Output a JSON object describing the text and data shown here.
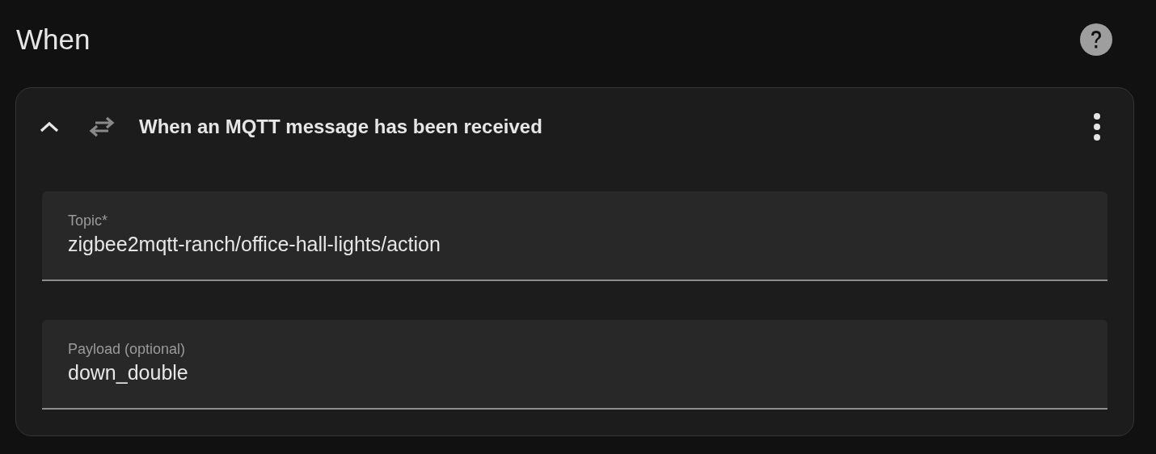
{
  "section": {
    "title": "When"
  },
  "trigger": {
    "title": "When an MQTT message has been received",
    "expanded": true,
    "fields": [
      {
        "label": "Topic*",
        "value": "zigbee2mqtt-ranch/office-hall-lights/action"
      },
      {
        "label": "Payload (optional)",
        "value": "down_double"
      }
    ]
  }
}
